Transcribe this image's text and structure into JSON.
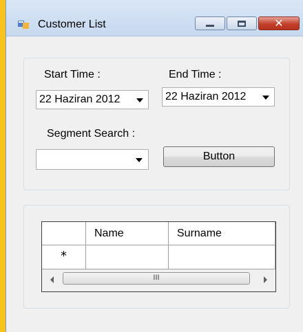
{
  "window": {
    "title": "Customer List"
  },
  "filters": {
    "start_time_label": "Start Time :",
    "start_time_value": "22 Haziran 2012",
    "end_time_label": "End Time :",
    "end_time_value": "22 Haziran 2012",
    "segment_search_label": "Segment Search :",
    "segment_search_value": "",
    "button_label": "Button"
  },
  "grid": {
    "columns": [
      "Name",
      "Surname"
    ],
    "new_row_marker": "*",
    "scroll_grip": "III"
  },
  "colors": {
    "desktop": "#f8c31a",
    "window_bg": "#f0f0f0",
    "close_button": "#c2402a"
  }
}
